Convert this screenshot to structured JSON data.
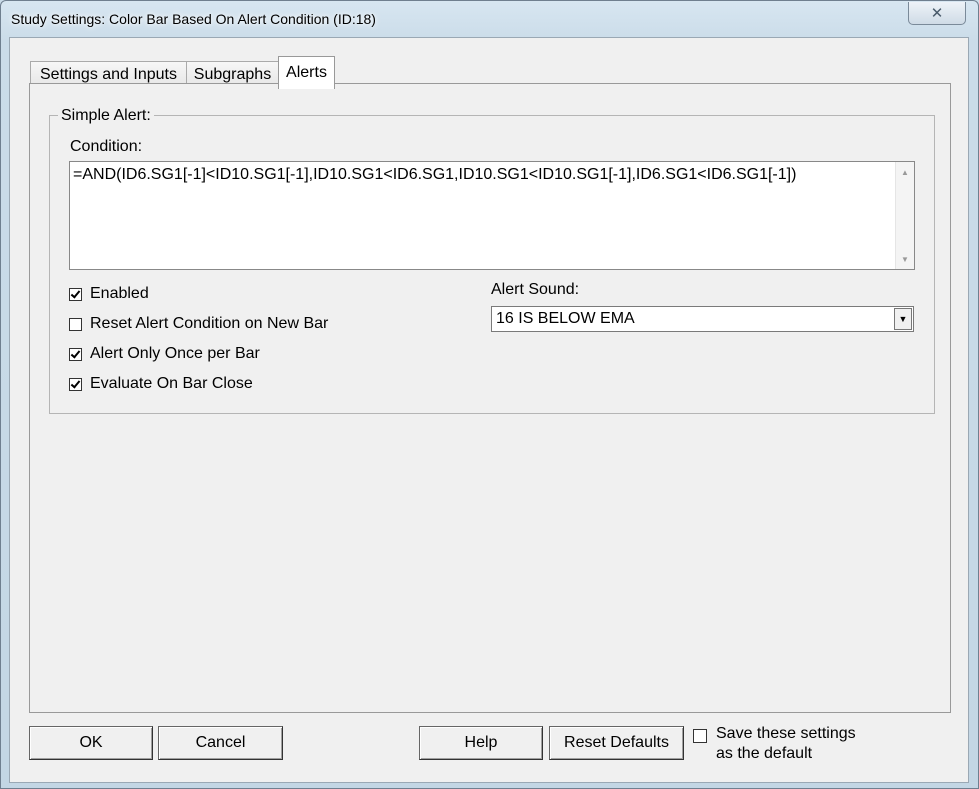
{
  "window": {
    "title": "Study Settings: Color Bar Based On Alert Condition (ID:18)",
    "close_glyph": "✕"
  },
  "tabs": [
    {
      "label": "Settings and Inputs",
      "active": false
    },
    {
      "label": "Subgraphs",
      "active": false
    },
    {
      "label": "Alerts",
      "active": true
    }
  ],
  "simple_alert": {
    "group_label": "Simple Alert:",
    "condition_label": "Condition:",
    "condition_value": "=AND(ID6.SG1[-1]<ID10.SG1[-1],ID10.SG1<ID6.SG1,ID10.SG1<ID10.SG1[-1],ID6.SG1<ID6.SG1[-1])",
    "checkboxes": [
      {
        "label": "Enabled",
        "checked": true
      },
      {
        "label": "Reset Alert Condition on New Bar",
        "checked": false
      },
      {
        "label": "Alert Only Once per Bar",
        "checked": true
      },
      {
        "label": "Evaluate On Bar Close",
        "checked": true
      }
    ],
    "alert_sound_label": "Alert Sound:",
    "alert_sound_value": "16 IS BELOW EMA"
  },
  "buttons": {
    "ok": "OK",
    "cancel": "Cancel",
    "help": "Help",
    "reset_defaults": "Reset Defaults"
  },
  "save_default": {
    "label_line1": "Save these settings",
    "label_line2": "as the default",
    "checked": false
  }
}
